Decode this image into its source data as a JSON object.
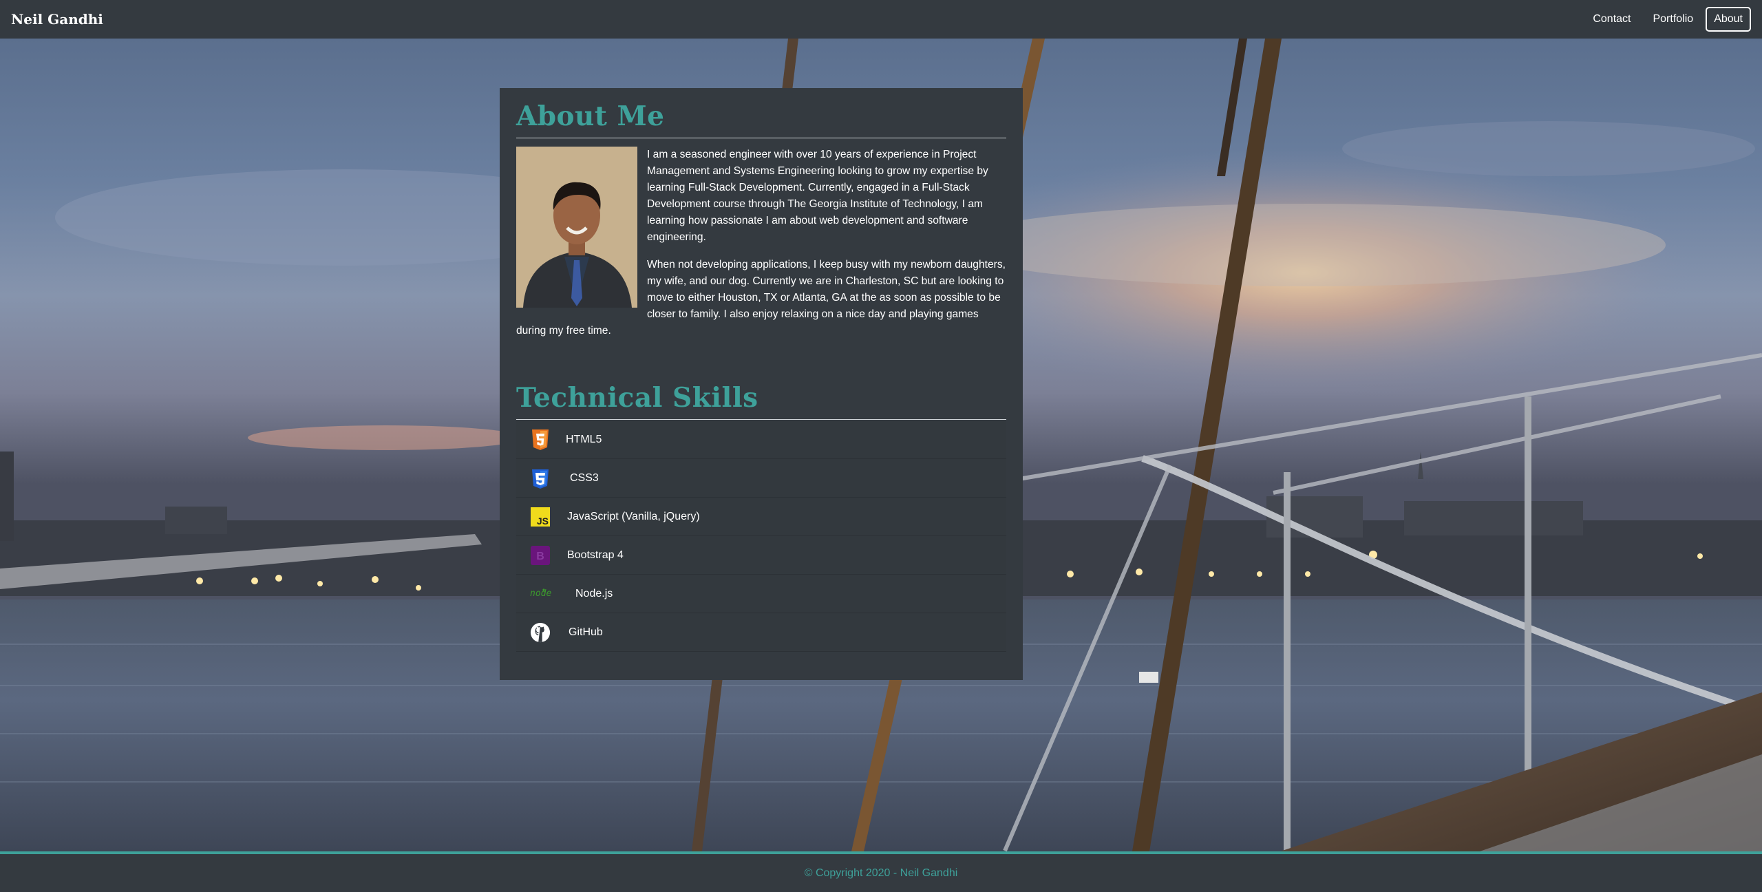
{
  "navbar": {
    "brand": "Neil Gandhi",
    "links": [
      {
        "label": "Contact"
      },
      {
        "label": "Portfolio"
      },
      {
        "label": "About"
      }
    ]
  },
  "about": {
    "title": "About Me",
    "paragraph_1": "I am a seasoned engineer with over 10 years of experience in Project Management and Systems Engineering looking to grow my expertise by learning Full-Stack Development. Currently, engaged in a Full-Stack Development course through The Georgia Institute of Technology, I am learning how passionate I am about web development and software engineering.",
    "paragraph_2": "When not developing applications, I keep busy with my newborn daughters, my wife, and our dog. Currently we are in Charleston, SC but are looking to move to either Houston, TX or Atlanta, GA at the as soon as possible to be closer to family. I also enjoy relaxing on a nice day and playing games during my free time."
  },
  "skills": {
    "title": "Technical Skills",
    "items": [
      {
        "label": "HTML5",
        "icon": "html5-icon"
      },
      {
        "label": "CSS3",
        "icon": "css3-icon"
      },
      {
        "label": "JavaScript (Vanilla, jQuery)",
        "icon": "javascript-icon"
      },
      {
        "label": "Bootstrap 4",
        "icon": "bootstrap-icon"
      },
      {
        "label": "Node.js",
        "icon": "nodejs-icon"
      },
      {
        "label": "GitHub",
        "icon": "github-icon"
      }
    ]
  },
  "footer": {
    "text": "© Copyright 2020 - Neil Gandhi"
  },
  "colors": {
    "accent": "#3ea19a",
    "navbar": "#343a40",
    "card": "#343a40"
  }
}
